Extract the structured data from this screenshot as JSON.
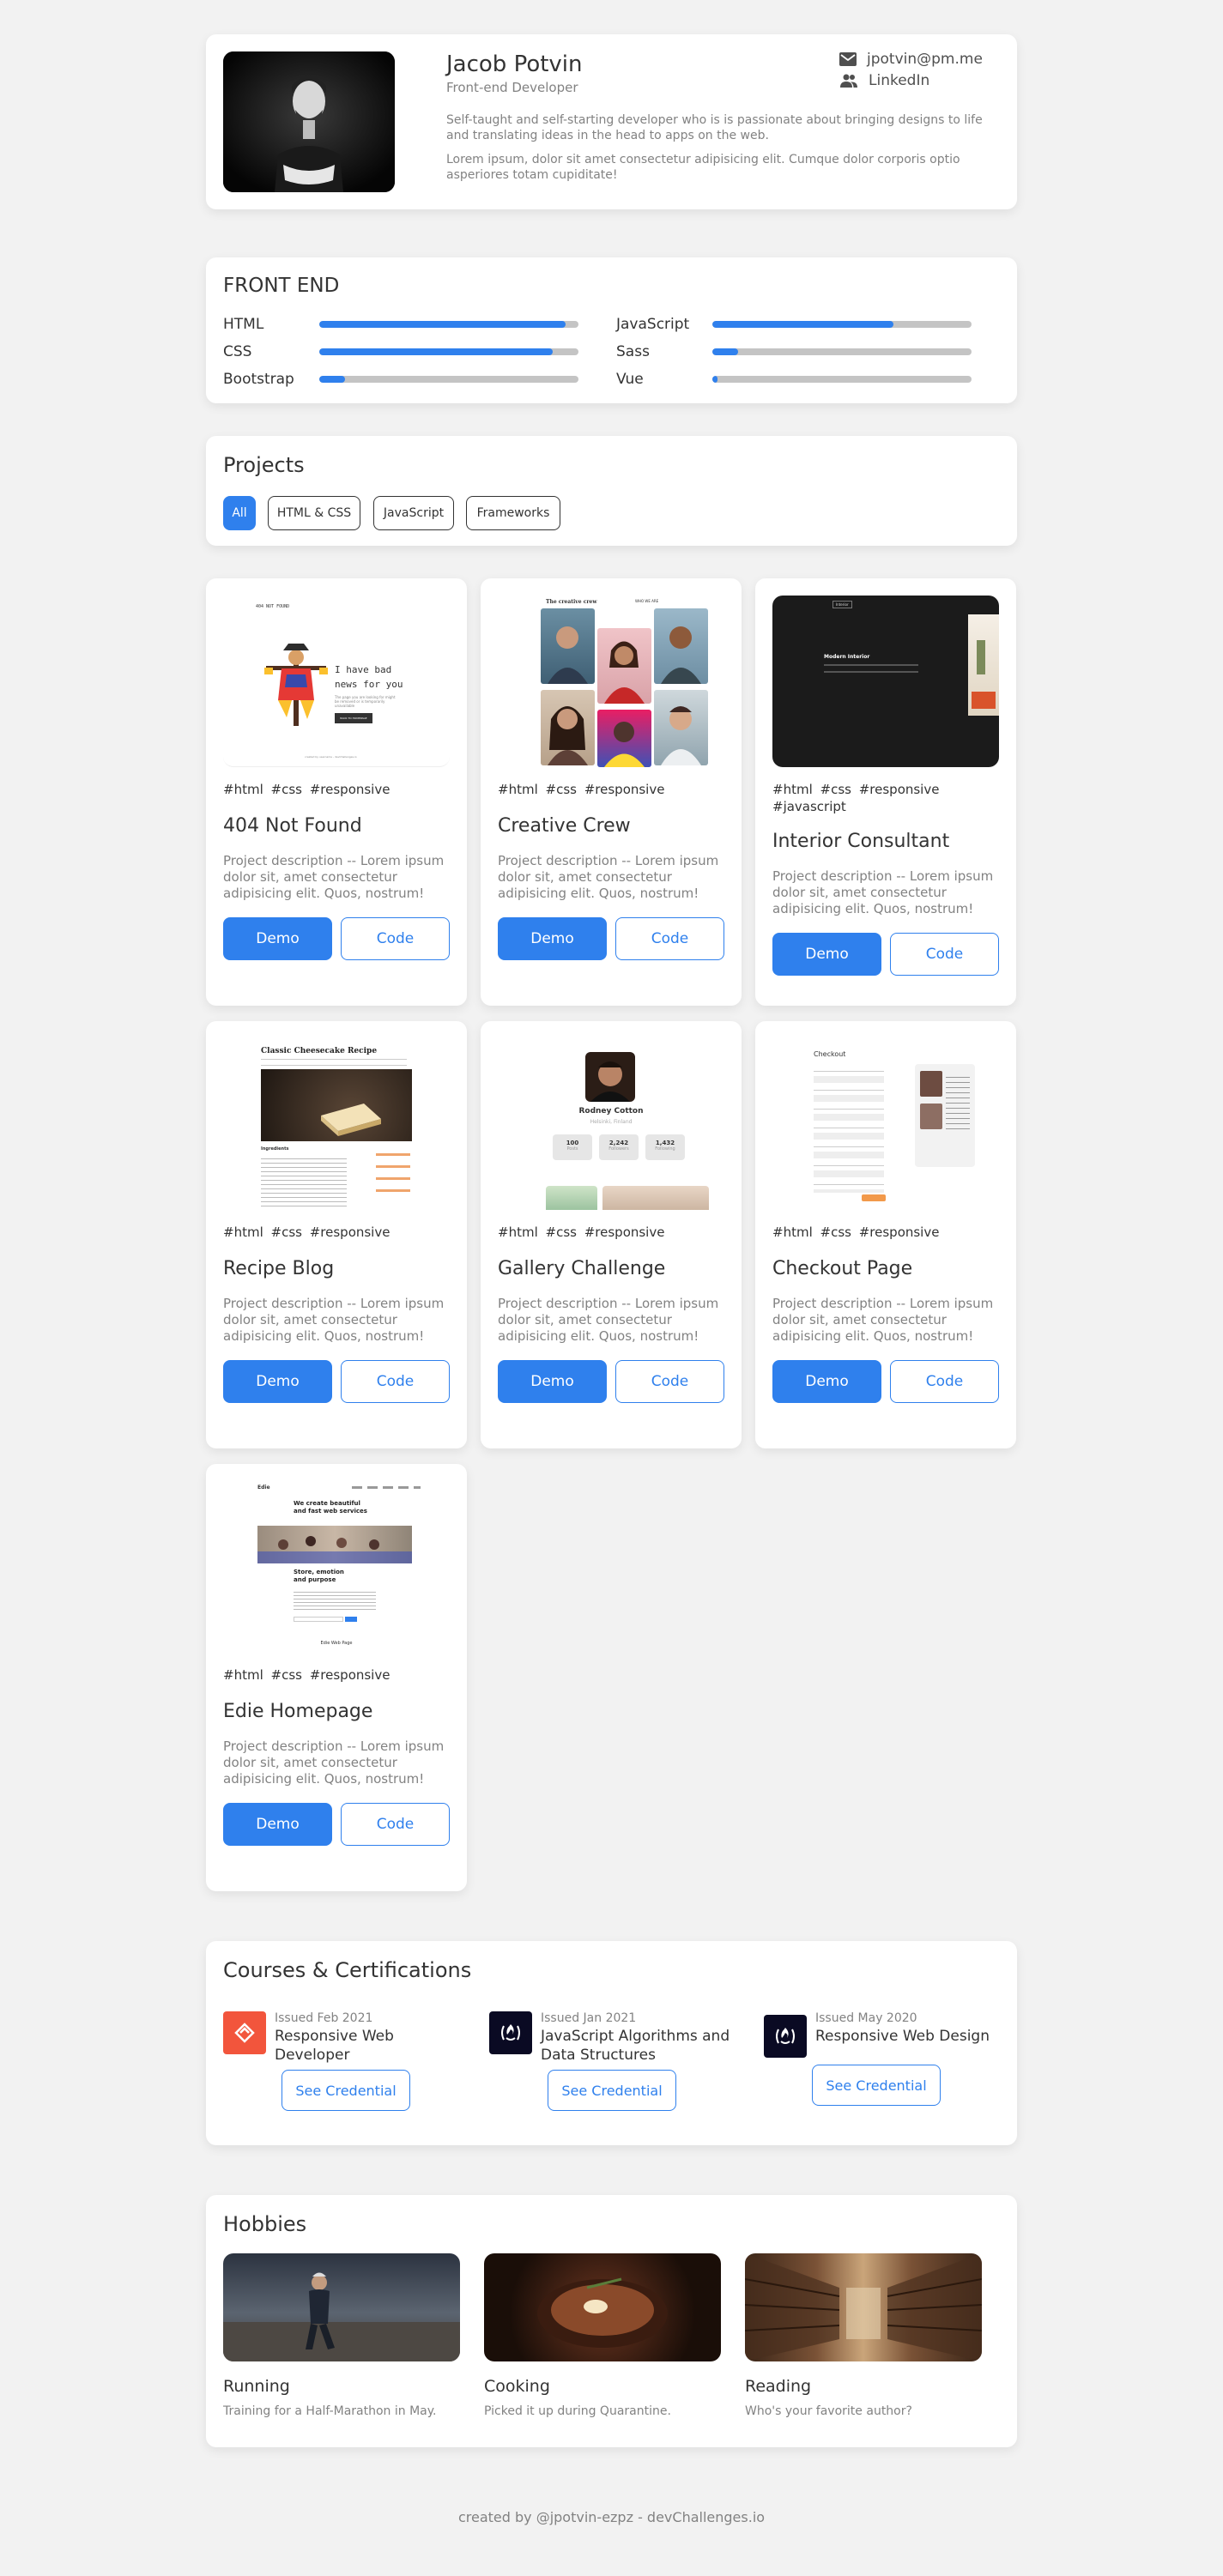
{
  "profile": {
    "name": "Jacob Potvin",
    "role": "Front-end Developer",
    "email": "jpotvin@pm.me",
    "linkedin": "LinkedIn",
    "bio1": "Self-taught and self-starting developer who is is passionate about bringing designs to life and translating ideas in the head to apps on the web.",
    "bio2": "Lorem ipsum, dolor sit amet consectetur adipisicing elit. Cumque dolor corporis optio asperiores totam cupiditate!"
  },
  "skills": {
    "title": "FRONT END",
    "items": [
      {
        "name": "HTML",
        "level": 0.95
      },
      {
        "name": "CSS",
        "level": 0.9
      },
      {
        "name": "Bootstrap",
        "level": 0.1
      },
      {
        "name": "JavaScript",
        "level": 0.7
      },
      {
        "name": "Sass",
        "level": 0.1
      },
      {
        "name": "Vue",
        "level": 0.02
      }
    ]
  },
  "projects": {
    "title": "Projects",
    "filters": [
      "All",
      "HTML & CSS",
      "JavaScript",
      "Frameworks"
    ],
    "active_filter": "All",
    "demo_label": "Demo",
    "code_label": "Code",
    "items": [
      {
        "tags": "#html #css #responsive",
        "title": "404 Not Found",
        "desc": "Project description -- Lorem ipsum dolor sit, amet consectetur adipisicing elit. Quos, nostrum!",
        "thumb_text": {
          "brand": "404 NOT FOUND",
          "headline": "I have bad news for you",
          "body": "The page you are looking for might be removed or is temporarily unavailable",
          "button": "BACK TO HOMEPAGE",
          "footer": "created by username - devChallenges.io"
        }
      },
      {
        "tags": "#html #css #responsive",
        "title": "Creative Crew",
        "desc": "Project description -- Lorem ipsum dolor sit, amet consectetur adipisicing elit. Quos, nostrum!",
        "thumb_text": {
          "headline": "The creative crew",
          "sub": "WHO WE ARE"
        }
      },
      {
        "tags": "#html #css #responsive #javascript",
        "title": "Interior Consultant",
        "desc": "Project description -- Lorem ipsum dolor sit, amet consectetur adipisicing elit. Quos, nostrum!",
        "thumb_text": {
          "brand": "Interior",
          "headline": "Modern Interior"
        }
      },
      {
        "tags": "#html #css #responsive",
        "title": "Recipe Blog",
        "desc": "Project description -- Lorem ipsum dolor sit, amet consectetur adipisicing elit. Quos, nostrum!",
        "thumb_text": {
          "headline": "Classic Cheesecake Recipe",
          "sub": "Ingredients"
        }
      },
      {
        "tags": "#html #css #responsive",
        "title": "Gallery Challenge",
        "desc": "Project description -- Lorem ipsum dolor sit, amet consectetur adipisicing elit. Quos, nostrum!",
        "thumb_text": {
          "name": "Rodney Cotton",
          "location": "Helsinki, Finland",
          "stats": [
            "100",
            "2,242",
            "1,432"
          ],
          "stat_labels": [
            "Posts",
            "Followers",
            "Following"
          ]
        }
      },
      {
        "tags": "#html #css #responsive",
        "title": "Checkout Page",
        "desc": "Project description -- Lorem ipsum dolor sit, amet consectetur adipisicing elit. Quos, nostrum!",
        "thumb_text": {
          "headline": "Checkout"
        }
      },
      {
        "tags": "#html #css #responsive",
        "title": "Edie Homepage",
        "desc": "Project description -- Lorem ipsum dolor sit, amet consectetur adipisicing elit. Quos, nostrum!",
        "thumb_text": {
          "brand": "Edie",
          "headline": "We create beautiful and fast web services",
          "sub": "Store, emotion and purpose",
          "footer": "Edie Web Page"
        }
      }
    ]
  },
  "courses": {
    "title": "Courses & Certifications",
    "cred_label": "See Credential",
    "items": [
      {
        "issued": "Issued Feb 2021",
        "name": "Responsive Web Developer"
      },
      {
        "issued": "Issued Jan 2021",
        "name": "JavaScript Algorithms and Data Structures"
      },
      {
        "issued": "Issued May 2020",
        "name": "Responsive Web Design"
      }
    ]
  },
  "hobbies": {
    "title": "Hobbies",
    "items": [
      {
        "name": "Running",
        "desc": "Training for a Half-Marathon in May."
      },
      {
        "name": "Cooking",
        "desc": "Picked it up during Quarantine."
      },
      {
        "name": "Reading",
        "desc": "Who's your favorite author?"
      }
    ]
  },
  "footer": "created by @jpotvin-ezpz - devChallenges.io",
  "colors": {
    "accent": "#2f80ed",
    "background": "#f2f2f2",
    "text": "#333333",
    "muted": "#828282",
    "track": "#c4c4c4"
  }
}
